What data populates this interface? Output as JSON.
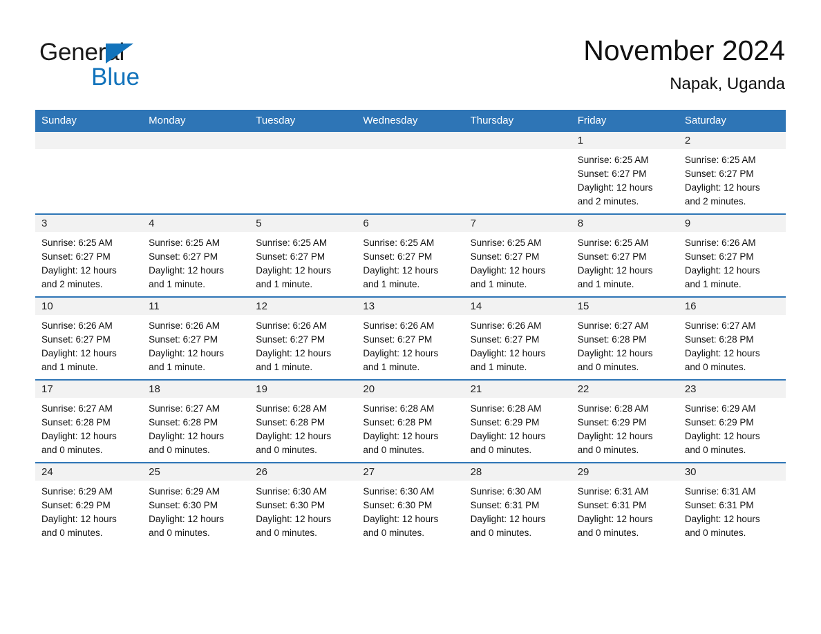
{
  "brand": {
    "word1": "General",
    "word2": "Blue",
    "flag_icon": "triangle-flag-icon",
    "accent_color": "#1273bb"
  },
  "header": {
    "month_title": "November 2024",
    "location": "Napak, Uganda"
  },
  "theme": {
    "header_blue": "#2e75b6",
    "daynum_gray": "#f2f2f2",
    "text_dark": "#111111"
  },
  "calendar": {
    "weekday_headers": [
      "Sunday",
      "Monday",
      "Tuesday",
      "Wednesday",
      "Thursday",
      "Friday",
      "Saturday"
    ],
    "weeks": [
      [
        {
          "day": "",
          "lines": []
        },
        {
          "day": "",
          "lines": []
        },
        {
          "day": "",
          "lines": []
        },
        {
          "day": "",
          "lines": []
        },
        {
          "day": "",
          "lines": []
        },
        {
          "day": "1",
          "lines": [
            "Sunrise: 6:25 AM",
            "Sunset: 6:27 PM",
            "Daylight: 12 hours",
            "and 2 minutes."
          ]
        },
        {
          "day": "2",
          "lines": [
            "Sunrise: 6:25 AM",
            "Sunset: 6:27 PM",
            "Daylight: 12 hours",
            "and 2 minutes."
          ]
        }
      ],
      [
        {
          "day": "3",
          "lines": [
            "Sunrise: 6:25 AM",
            "Sunset: 6:27 PM",
            "Daylight: 12 hours",
            "and 2 minutes."
          ]
        },
        {
          "day": "4",
          "lines": [
            "Sunrise: 6:25 AM",
            "Sunset: 6:27 PM",
            "Daylight: 12 hours",
            "and 1 minute."
          ]
        },
        {
          "day": "5",
          "lines": [
            "Sunrise: 6:25 AM",
            "Sunset: 6:27 PM",
            "Daylight: 12 hours",
            "and 1 minute."
          ]
        },
        {
          "day": "6",
          "lines": [
            "Sunrise: 6:25 AM",
            "Sunset: 6:27 PM",
            "Daylight: 12 hours",
            "and 1 minute."
          ]
        },
        {
          "day": "7",
          "lines": [
            "Sunrise: 6:25 AM",
            "Sunset: 6:27 PM",
            "Daylight: 12 hours",
            "and 1 minute."
          ]
        },
        {
          "day": "8",
          "lines": [
            "Sunrise: 6:25 AM",
            "Sunset: 6:27 PM",
            "Daylight: 12 hours",
            "and 1 minute."
          ]
        },
        {
          "day": "9",
          "lines": [
            "Sunrise: 6:26 AM",
            "Sunset: 6:27 PM",
            "Daylight: 12 hours",
            "and 1 minute."
          ]
        }
      ],
      [
        {
          "day": "10",
          "lines": [
            "Sunrise: 6:26 AM",
            "Sunset: 6:27 PM",
            "Daylight: 12 hours",
            "and 1 minute."
          ]
        },
        {
          "day": "11",
          "lines": [
            "Sunrise: 6:26 AM",
            "Sunset: 6:27 PM",
            "Daylight: 12 hours",
            "and 1 minute."
          ]
        },
        {
          "day": "12",
          "lines": [
            "Sunrise: 6:26 AM",
            "Sunset: 6:27 PM",
            "Daylight: 12 hours",
            "and 1 minute."
          ]
        },
        {
          "day": "13",
          "lines": [
            "Sunrise: 6:26 AM",
            "Sunset: 6:27 PM",
            "Daylight: 12 hours",
            "and 1 minute."
          ]
        },
        {
          "day": "14",
          "lines": [
            "Sunrise: 6:26 AM",
            "Sunset: 6:27 PM",
            "Daylight: 12 hours",
            "and 1 minute."
          ]
        },
        {
          "day": "15",
          "lines": [
            "Sunrise: 6:27 AM",
            "Sunset: 6:28 PM",
            "Daylight: 12 hours",
            "and 0 minutes."
          ]
        },
        {
          "day": "16",
          "lines": [
            "Sunrise: 6:27 AM",
            "Sunset: 6:28 PM",
            "Daylight: 12 hours",
            "and 0 minutes."
          ]
        }
      ],
      [
        {
          "day": "17",
          "lines": [
            "Sunrise: 6:27 AM",
            "Sunset: 6:28 PM",
            "Daylight: 12 hours",
            "and 0 minutes."
          ]
        },
        {
          "day": "18",
          "lines": [
            "Sunrise: 6:27 AM",
            "Sunset: 6:28 PM",
            "Daylight: 12 hours",
            "and 0 minutes."
          ]
        },
        {
          "day": "19",
          "lines": [
            "Sunrise: 6:28 AM",
            "Sunset: 6:28 PM",
            "Daylight: 12 hours",
            "and 0 minutes."
          ]
        },
        {
          "day": "20",
          "lines": [
            "Sunrise: 6:28 AM",
            "Sunset: 6:28 PM",
            "Daylight: 12 hours",
            "and 0 minutes."
          ]
        },
        {
          "day": "21",
          "lines": [
            "Sunrise: 6:28 AM",
            "Sunset: 6:29 PM",
            "Daylight: 12 hours",
            "and 0 minutes."
          ]
        },
        {
          "day": "22",
          "lines": [
            "Sunrise: 6:28 AM",
            "Sunset: 6:29 PM",
            "Daylight: 12 hours",
            "and 0 minutes."
          ]
        },
        {
          "day": "23",
          "lines": [
            "Sunrise: 6:29 AM",
            "Sunset: 6:29 PM",
            "Daylight: 12 hours",
            "and 0 minutes."
          ]
        }
      ],
      [
        {
          "day": "24",
          "lines": [
            "Sunrise: 6:29 AM",
            "Sunset: 6:29 PM",
            "Daylight: 12 hours",
            "and 0 minutes."
          ]
        },
        {
          "day": "25",
          "lines": [
            "Sunrise: 6:29 AM",
            "Sunset: 6:30 PM",
            "Daylight: 12 hours",
            "and 0 minutes."
          ]
        },
        {
          "day": "26",
          "lines": [
            "Sunrise: 6:30 AM",
            "Sunset: 6:30 PM",
            "Daylight: 12 hours",
            "and 0 minutes."
          ]
        },
        {
          "day": "27",
          "lines": [
            "Sunrise: 6:30 AM",
            "Sunset: 6:30 PM",
            "Daylight: 12 hours",
            "and 0 minutes."
          ]
        },
        {
          "day": "28",
          "lines": [
            "Sunrise: 6:30 AM",
            "Sunset: 6:31 PM",
            "Daylight: 12 hours",
            "and 0 minutes."
          ]
        },
        {
          "day": "29",
          "lines": [
            "Sunrise: 6:31 AM",
            "Sunset: 6:31 PM",
            "Daylight: 12 hours",
            "and 0 minutes."
          ]
        },
        {
          "day": "30",
          "lines": [
            "Sunrise: 6:31 AM",
            "Sunset: 6:31 PM",
            "Daylight: 12 hours",
            "and 0 minutes."
          ]
        }
      ]
    ]
  }
}
